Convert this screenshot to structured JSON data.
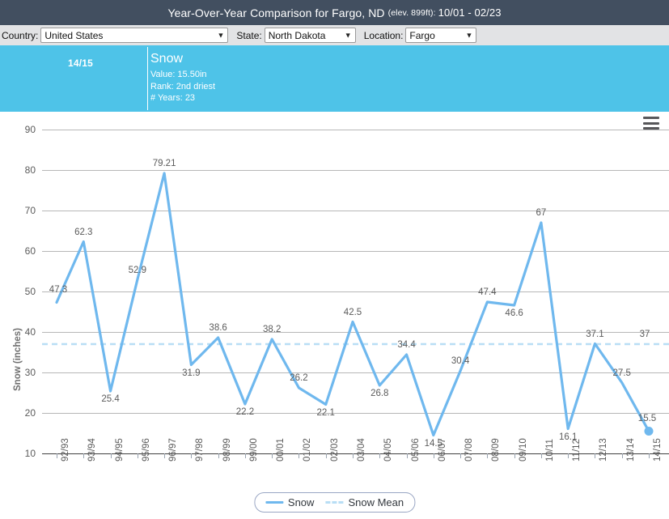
{
  "titlebar": {
    "main": "Year-Over-Year Comparison for Fargo, ND",
    "elevation": "(elev. 899ft):",
    "range": "10/01 - 02/23"
  },
  "controls": {
    "country_label": "Country:",
    "country_value": "United States",
    "state_label": "State:",
    "state_value": "North Dakota",
    "location_label": "Location:",
    "location_value": "Fargo",
    "chevron": "▼"
  },
  "tooltip": {
    "x_label": "14/15",
    "title": "Snow",
    "value": "Value: 15.50in",
    "rank": "Rank: 2nd driest",
    "years": "# Years: 23"
  },
  "menu": {
    "icon": "hamburger-menu-icon"
  },
  "legend": {
    "snow": "Snow",
    "snow_mean": "Snow Mean"
  },
  "colors": {
    "titlebar_bg": "#424f60",
    "controls_bg": "#e2e3e5",
    "highlight_band": "#4ec3e8",
    "series": "#6fb8ee",
    "mean": "#b8def5",
    "grid": "#b7b7b7",
    "text": "#5b5b5b"
  },
  "chart_data": {
    "type": "line",
    "title": "Year-Over-Year Comparison for Fargo, ND",
    "xlabel": "",
    "ylabel": "Snow (inches)",
    "ylim": [
      10,
      90
    ],
    "yticks": [
      10,
      20,
      30,
      40,
      50,
      60,
      70,
      80,
      90
    ],
    "grid": true,
    "legend_position": "bottom",
    "categories": [
      "92/93",
      "93/94",
      "94/95",
      "95/96",
      "96/97",
      "97/98",
      "98/99",
      "99/00",
      "00/01",
      "01/02",
      "02/03",
      "03/04",
      "04/05",
      "05/06",
      "06/07",
      "07/08",
      "08/09",
      "09/10",
      "10/11",
      "11/12",
      "12/13",
      "13/14",
      "14/15"
    ],
    "series": [
      {
        "name": "Snow",
        "values": [
          47.3,
          62.3,
          25.4,
          52.9,
          79.21,
          31.9,
          38.6,
          22.2,
          38.2,
          26.2,
          22.1,
          42.5,
          26.8,
          34.4,
          14.5,
          30.4,
          47.4,
          46.6,
          67,
          16.1,
          37.1,
          27.5,
          15.5
        ],
        "labels": [
          "47.3",
          "62.3",
          "25.4",
          "52.9",
          "79.21",
          "31.9",
          "38.6",
          "22.2",
          "38.2",
          "26.2",
          "22.1",
          "42.5",
          "26.8",
          "34.4",
          "14.5",
          "30.4",
          "47.4",
          "46.6",
          "67",
          "16.1",
          "37.1",
          "27.5",
          "15.5"
        ],
        "style": "solid",
        "color": "#6fb8ee",
        "highlight_index": 22
      },
      {
        "name": "Snow Mean",
        "value": 37,
        "label": "37",
        "style": "dashed",
        "color": "#b8def5"
      }
    ]
  }
}
